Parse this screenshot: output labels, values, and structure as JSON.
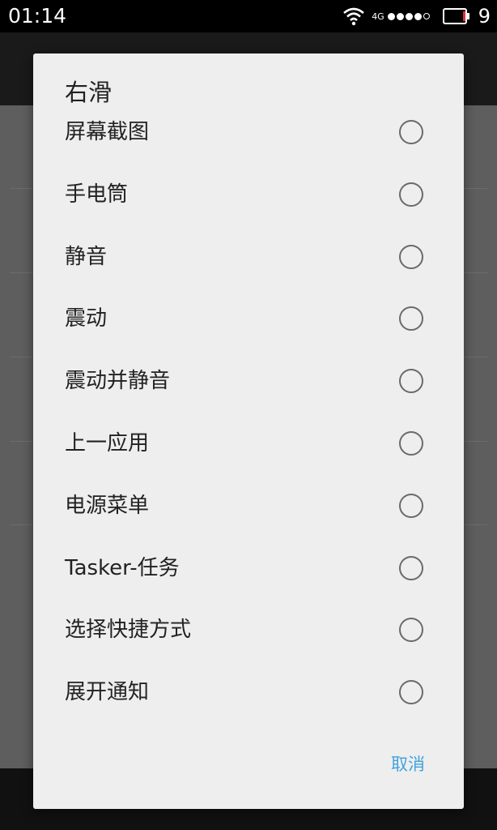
{
  "status_bar": {
    "time": "01:14",
    "network_type": "4G",
    "battery_level": "9",
    "icons": [
      "wifi-icon",
      "signal-icon",
      "battery-icon"
    ]
  },
  "dialog": {
    "title": "右滑",
    "options": [
      {
        "label": "屏幕截图",
        "selected": false
      },
      {
        "label": "手电筒",
        "selected": false
      },
      {
        "label": "静音",
        "selected": false
      },
      {
        "label": "震动",
        "selected": false
      },
      {
        "label": "震动并静音",
        "selected": false
      },
      {
        "label": "上一应用",
        "selected": false
      },
      {
        "label": "电源菜单",
        "selected": false
      },
      {
        "label": "Tasker-任务",
        "selected": false
      },
      {
        "label": "选择快捷方式",
        "selected": false
      },
      {
        "label": "展开通知",
        "selected": false
      }
    ],
    "cancel_label": "取消"
  },
  "colors": {
    "accent": "#42a2dc",
    "dialog_bg": "#eeeeee",
    "radio_border": "#6a6a6a",
    "status_bar_bg": "#000000"
  }
}
